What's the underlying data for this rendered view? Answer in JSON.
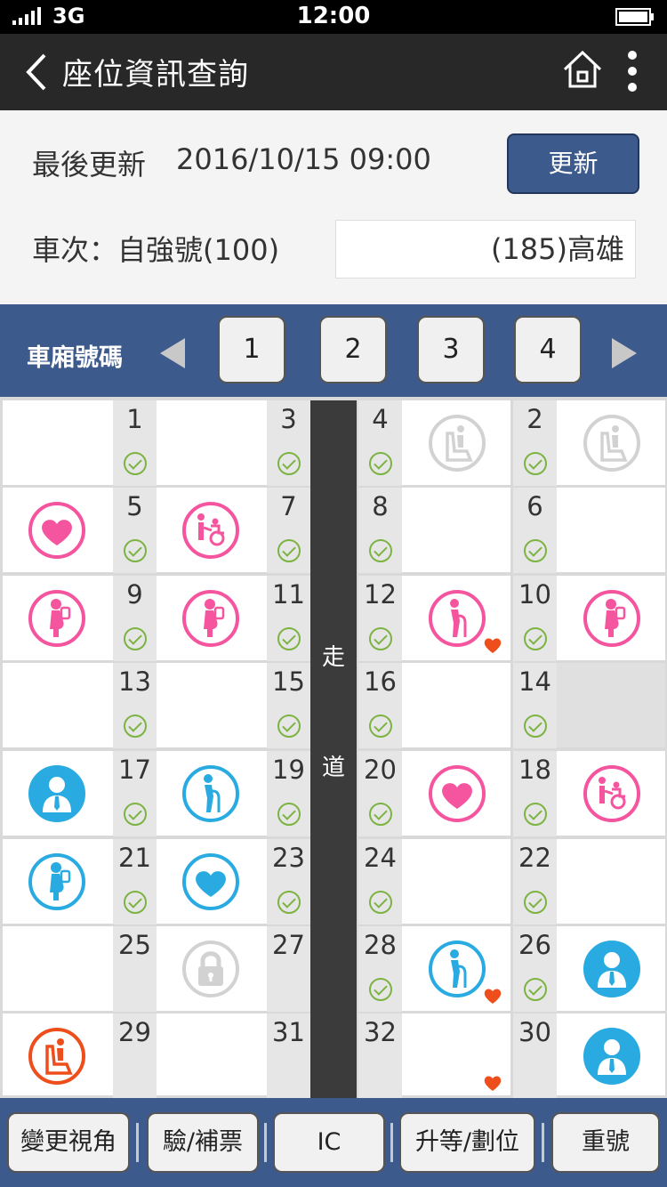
{
  "status_bar": {
    "network": "3G",
    "time": "12:00"
  },
  "header": {
    "title": "座位資訊查詢"
  },
  "info": {
    "update_label": "最後更新",
    "update_time": "2016/10/15 09:00",
    "refresh_label": "更新",
    "train_label": "車次：自強號(100)",
    "destination": "(185)高雄"
  },
  "car_bar": {
    "label": "車廂號碼",
    "cars": [
      "1",
      "2",
      "3",
      "4"
    ]
  },
  "aisle": {
    "chars": [
      "走",
      "道"
    ]
  },
  "seats": {
    "left": [
      [
        {
          "num": "1",
          "icon": "",
          "check": true
        },
        {
          "num": "3",
          "icon": "",
          "check": true
        }
      ],
      [
        {
          "num": "5",
          "icon": "heart-icon",
          "check": true
        },
        {
          "num": "7",
          "icon": "wheelchair-icon",
          "check": true
        }
      ],
      [
        {
          "num": "9",
          "icon": "pregnant-icon",
          "check": true
        },
        {
          "num": "11",
          "icon": "pregnant-icon",
          "check": true
        }
      ],
      [
        {
          "num": "13",
          "icon": "",
          "check": true
        },
        {
          "num": "15",
          "icon": "",
          "check": true
        }
      ],
      [
        {
          "num": "17",
          "icon": "businessman-icon",
          "check": true
        },
        {
          "num": "19",
          "icon": "elder-icon",
          "check": true
        }
      ],
      [
        {
          "num": "21",
          "icon": "pregnant-icon",
          "check": true
        },
        {
          "num": "23",
          "icon": "heart-icon",
          "check": true
        }
      ],
      [
        {
          "num": "25",
          "icon": "",
          "check": false
        },
        {
          "num": "27",
          "icon": "lock-icon",
          "check": false
        }
      ],
      [
        {
          "num": "29",
          "icon": "seat-icon",
          "check": false
        },
        {
          "num": "31",
          "icon": "",
          "check": false
        }
      ]
    ],
    "right": [
      [
        {
          "num": "4",
          "icon": "seat-icon",
          "check": true
        },
        {
          "num": "2",
          "icon": "seat-icon",
          "check": true
        }
      ],
      [
        {
          "num": "8",
          "icon": "",
          "check": true
        },
        {
          "num": "6",
          "icon": "",
          "check": true
        }
      ],
      [
        {
          "num": "12",
          "icon": "elder-icon",
          "check": true,
          "fav": true
        },
        {
          "num": "10",
          "icon": "pregnant-icon",
          "check": true
        }
      ],
      [
        {
          "num": "16",
          "icon": "",
          "check": true
        },
        {
          "num": "14",
          "icon": "",
          "check": true,
          "grey": true
        }
      ],
      [
        {
          "num": "20",
          "icon": "heart-icon",
          "check": true
        },
        {
          "num": "18",
          "icon": "wheelchair-icon",
          "check": true
        }
      ],
      [
        {
          "num": "24",
          "icon": "",
          "check": true
        },
        {
          "num": "22",
          "icon": "",
          "check": true
        }
      ],
      [
        {
          "num": "28",
          "icon": "elder-icon",
          "check": true,
          "fav": true
        },
        {
          "num": "26",
          "icon": "businessman-icon",
          "check": true
        }
      ],
      [
        {
          "num": "32",
          "icon": "",
          "check": false,
          "fav": true
        },
        {
          "num": "30",
          "icon": "businessman-icon",
          "check": false
        }
      ]
    ]
  },
  "colors": {
    "pink": "#f5559f",
    "blue": "#29abe2",
    "grey": "#d2d2d2",
    "orange": "#ee4e1b",
    "header_blue": "#3d5a8c"
  },
  "bottom": {
    "buttons": [
      "變更視角",
      "驗/補票",
      "IC",
      "升等/劃位",
      "重號"
    ]
  }
}
